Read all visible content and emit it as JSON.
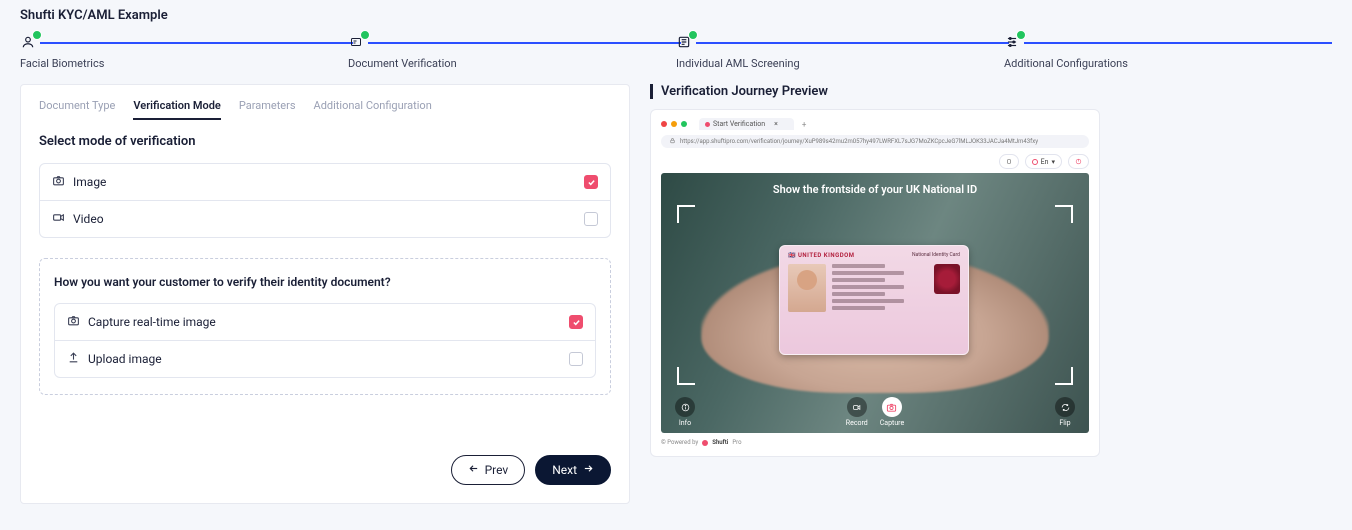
{
  "page_title": "Shufti KYC/AML Example",
  "stepper": [
    {
      "label": "Facial Biometrics",
      "done": true
    },
    {
      "label": "Document Verification",
      "done": true
    },
    {
      "label": "Individual AML Screening",
      "done": true
    },
    {
      "label": "Additional Configurations",
      "done": true
    }
  ],
  "tabs": [
    {
      "label": "Document Type",
      "active": false
    },
    {
      "label": "Verification Mode",
      "active": true
    },
    {
      "label": "Parameters",
      "active": false
    },
    {
      "label": "Additional Configuration",
      "active": false
    }
  ],
  "section_heading": "Select mode of verification",
  "mode_options": [
    {
      "icon": "camera",
      "label": "Image",
      "checked": true
    },
    {
      "icon": "video",
      "label": "Video",
      "checked": false
    }
  ],
  "sub_panel_heading": "How you want your customer to verify their identity document?",
  "verify_options": [
    {
      "icon": "camera",
      "label": "Capture real-time image",
      "checked": true
    },
    {
      "icon": "upload",
      "label": "Upload image",
      "checked": false
    }
  ],
  "buttons": {
    "prev": "Prev",
    "next": "Next"
  },
  "preview": {
    "title": "Verification Journey Preview",
    "browser_tab": "Start Verification",
    "url": "https://app.shuftipro.com/verification/journey/XuP989s42mu2m057hy497LWRFXL7sJG7MoZKCpcJeG7lMLJOK33JACJa4MtJm43fxy",
    "lang": "En",
    "scene_caption": "Show the frontside of your UK National ID",
    "id_country": "UNITED KINGDOM",
    "id_doc_name": "National Identity Card",
    "controls": {
      "info": "Info",
      "record": "Record",
      "capture": "Capture",
      "flip": "Flip"
    },
    "powered_prefix": "© Powered by",
    "powered_brand": "Shufti",
    "powered_suffix": "Pro"
  },
  "colors": {
    "accent": "#2b4fff",
    "danger": "#ef4d6e",
    "ok": "#22c55e"
  }
}
